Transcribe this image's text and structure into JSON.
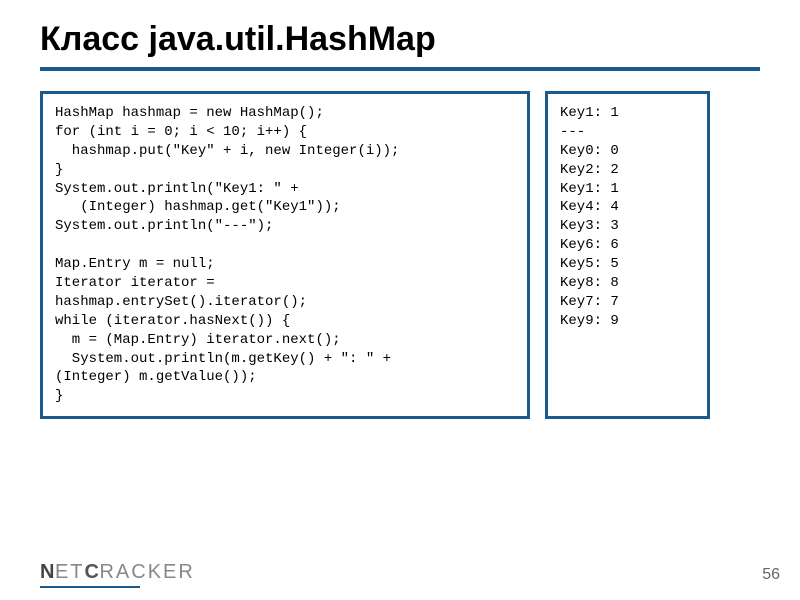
{
  "slide": {
    "title": "Класс java.util.HashMap",
    "code_left": "HashMap hashmap = new HashMap();\nfor (int i = 0; i < 10; i++) {\n  hashmap.put(\"Key\" + i, new Integer(i));\n}\nSystem.out.println(\"Key1: \" +\n   (Integer) hashmap.get(\"Key1\"));\nSystem.out.println(\"---\");\n\nMap.Entry m = null;\nIterator iterator =\nhashmap.entrySet().iterator();\nwhile (iterator.hasNext()) {\n  m = (Map.Entry) iterator.next();\n  System.out.println(m.getKey() + \": \" +\n(Integer) m.getValue());\n}",
    "code_right": "Key1: 1\n---\nKey0: 0\nKey2: 2\nKey1: 1\nKey4: 4\nKey3: 3\nKey6: 6\nKey5: 5\nKey8: 8\nKey7: 7\nKey9: 9"
  },
  "footer": {
    "brand_n": "N",
    "brand_et": "ET",
    "brand_c": "C",
    "brand_racker": "RACKER",
    "page": "56"
  }
}
